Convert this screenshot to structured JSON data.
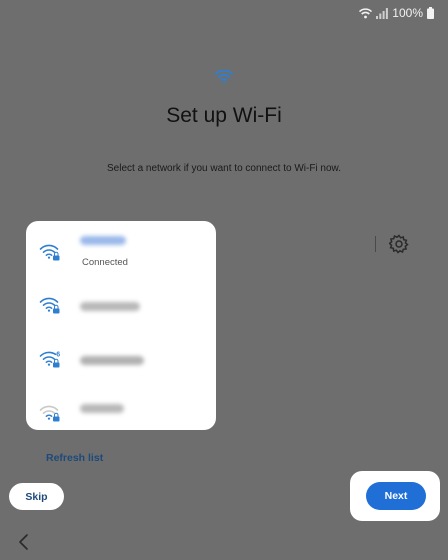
{
  "status_bar": {
    "battery_percent": "100%",
    "icons": [
      "wifi-icon",
      "signal-icon",
      "battery-icon"
    ]
  },
  "header": {
    "icon": "wifi-icon",
    "title": "Set up Wi-Fi",
    "subtitle": "Select a network if you want to connect to Wi-Fi now."
  },
  "toolbar": {
    "settings_icon": "gear-icon"
  },
  "networks": [
    {
      "status": "Connected",
      "signal_bars": 3,
      "secured": true,
      "wifi6": false,
      "name_color": "#9ab8ea"
    },
    {
      "status": "",
      "signal_bars": 3,
      "secured": true,
      "wifi6": false,
      "name_color": "#b8b8b8"
    },
    {
      "status": "",
      "signal_bars": 3,
      "secured": true,
      "wifi6": true,
      "name_color": "#b0b0b0"
    },
    {
      "status": "",
      "signal_bars": 1,
      "secured": true,
      "wifi6": false,
      "name_color": "#b8b8b8"
    }
  ],
  "actions": {
    "refresh_label": "Refresh list",
    "skip_label": "Skip",
    "next_label": "Next"
  },
  "colors": {
    "background": "#6e6e6e",
    "accent": "#1f6fd6",
    "link": "#1e4a7a",
    "wifi_icon": "#2f7fd0"
  }
}
